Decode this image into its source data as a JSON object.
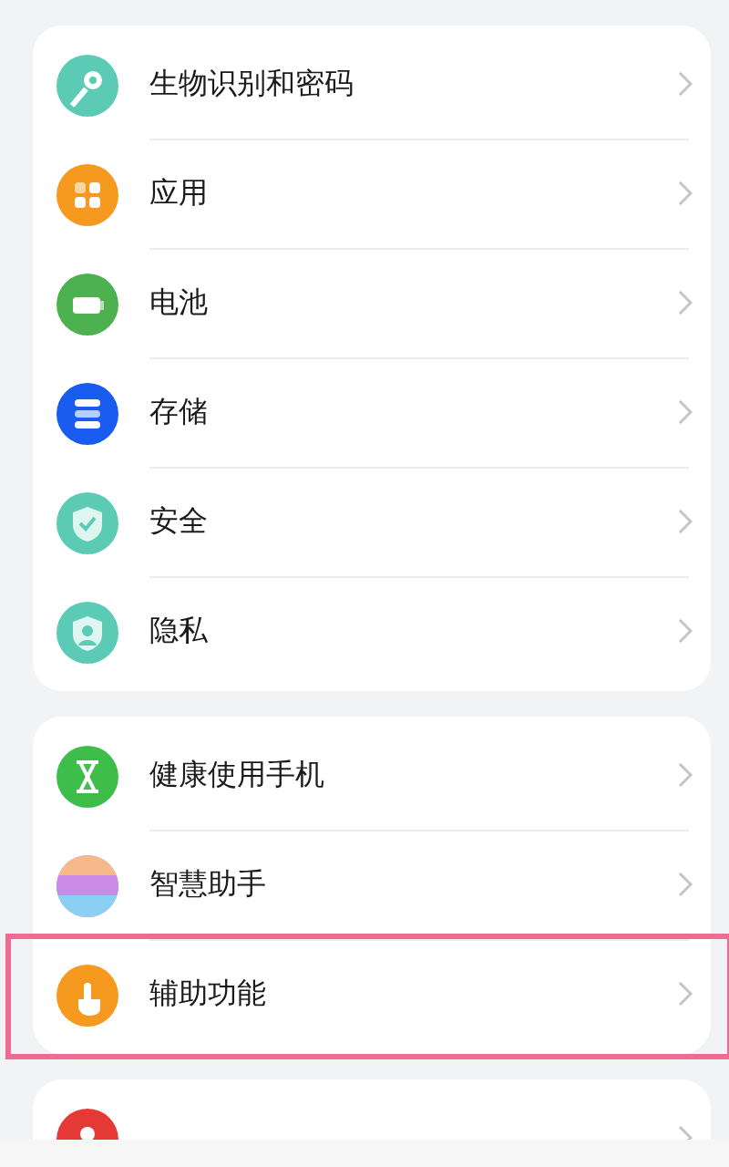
{
  "sections": [
    {
      "items": [
        {
          "kind": "key",
          "color": "#5ccbb6",
          "label": "生物识别和密码",
          "highlighted": false
        },
        {
          "kind": "apps",
          "color": "#f59a1f",
          "label": "应用",
          "highlighted": false
        },
        {
          "kind": "battery",
          "color": "#4cb14e",
          "label": "电池",
          "highlighted": false
        },
        {
          "kind": "storage",
          "color": "#1a5cf0",
          "label": "存储",
          "highlighted": false
        },
        {
          "kind": "shield",
          "color": "#5ccbb6",
          "label": "安全",
          "highlighted": false
        },
        {
          "kind": "privacy",
          "color": "#5ccbb6",
          "label": "隐私",
          "highlighted": false
        }
      ]
    },
    {
      "items": [
        {
          "kind": "hourglass",
          "color": "#3fbd4a",
          "label": "健康使用手机",
          "highlighted": false
        },
        {
          "kind": "assistant",
          "color": "#c98be6",
          "label": "智慧助手",
          "highlighted": false
        },
        {
          "kind": "touch",
          "color": "#f59a1f",
          "label": "辅助功能",
          "highlighted": true
        }
      ]
    },
    {
      "items": [
        {
          "kind": "user",
          "color": "#e53935"
        }
      ]
    }
  ]
}
